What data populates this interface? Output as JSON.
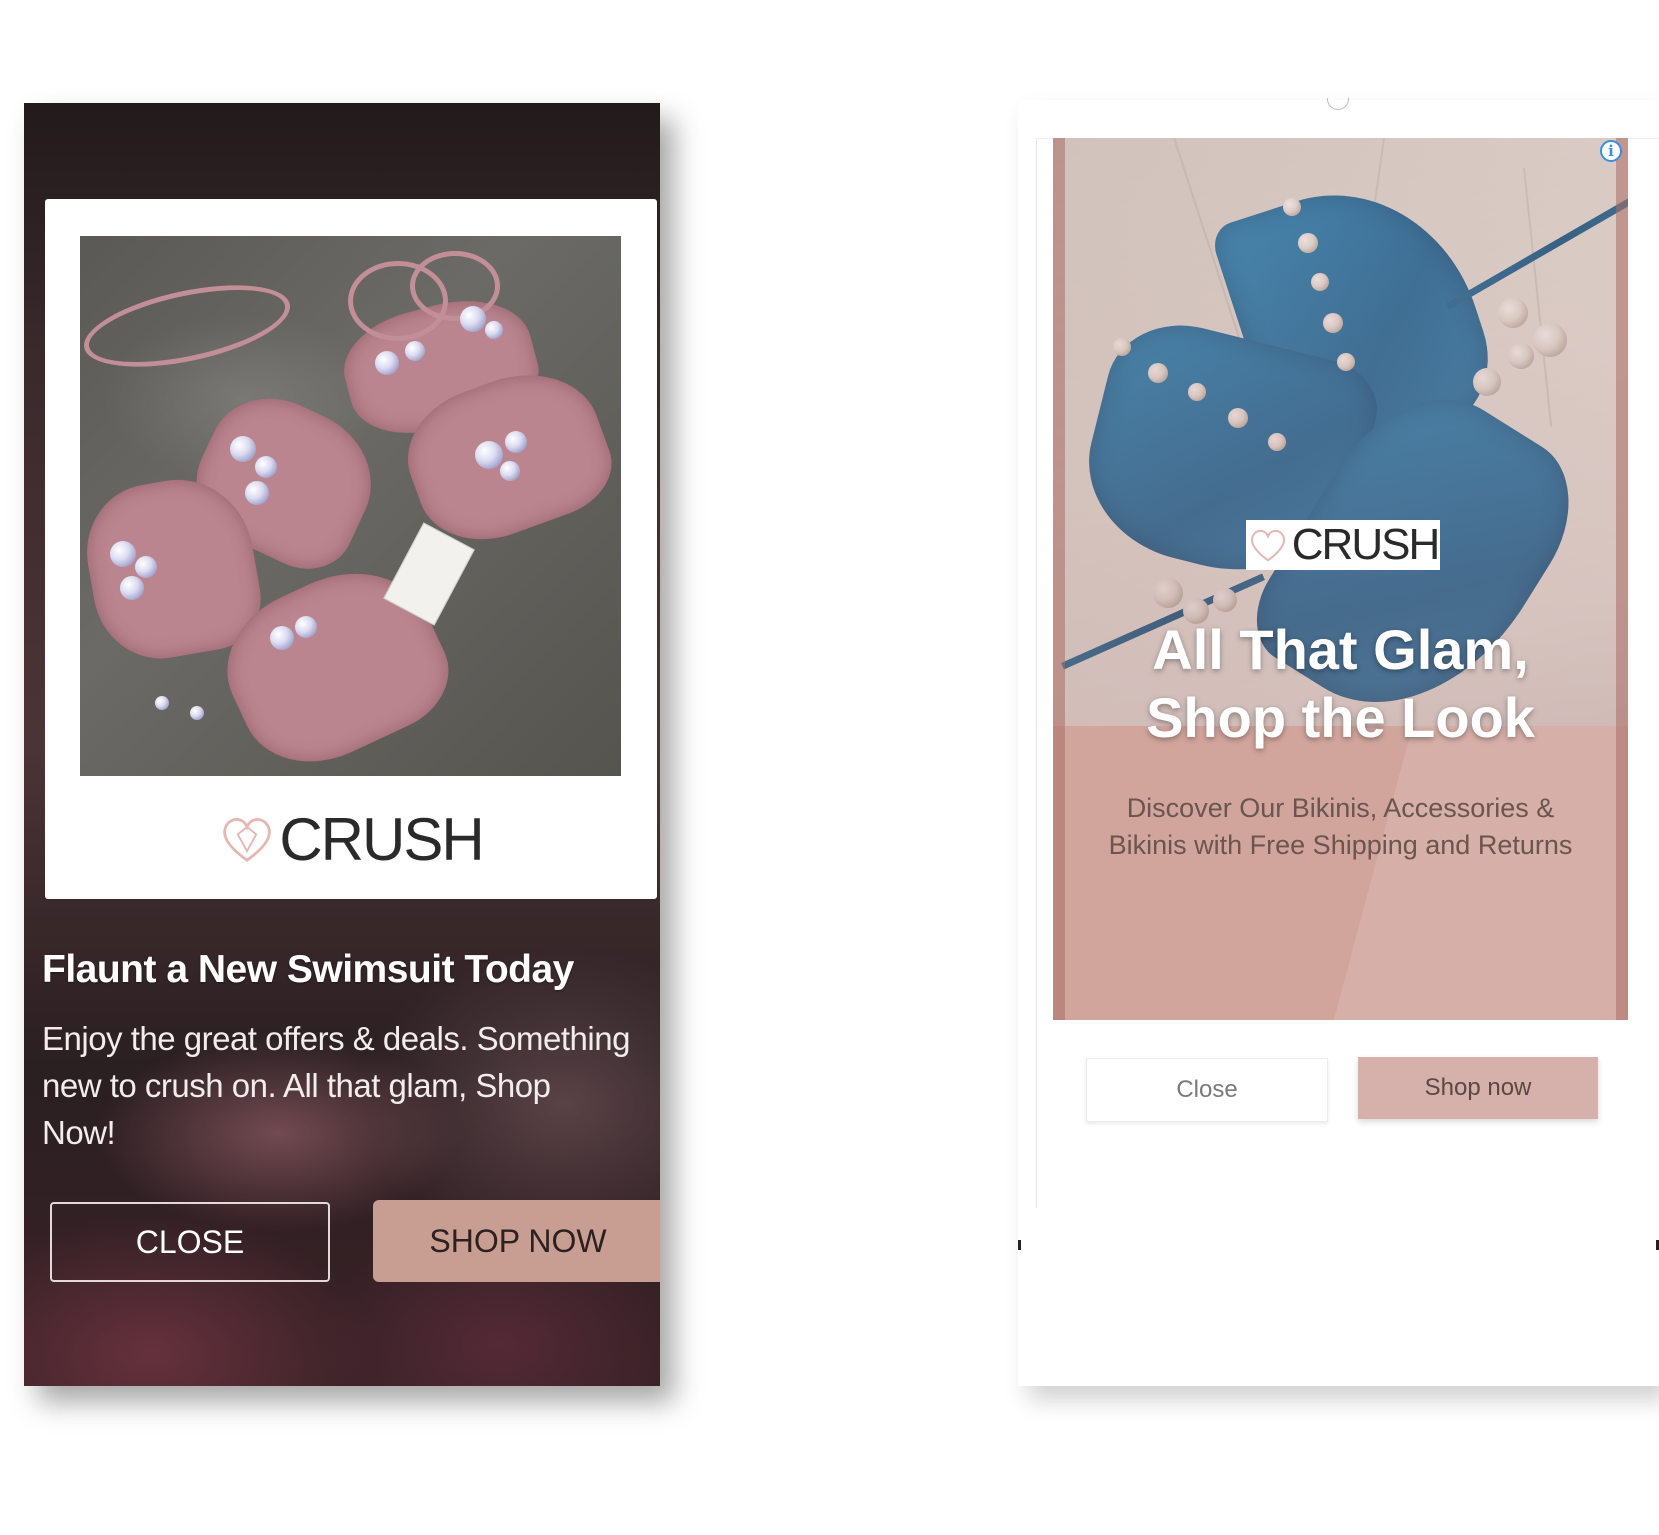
{
  "left_ad": {
    "brand_name": "CRUSH",
    "headline": "Flaunt a New Swimsuit Today",
    "body": "Enjoy the great offers & deals. Something new to crush on. All that glam, Shop Now!",
    "close_label": "CLOSE",
    "shop_label": "SHOP NOW",
    "colors": {
      "background": "#3a2a2c",
      "shop_button": "#c89e93",
      "product": "#bb8590"
    }
  },
  "right_ad": {
    "brand_name": "CRUSH",
    "headline_line1": "All That Glam,",
    "headline_line2": "Shop the Look",
    "sub_line1": "Discover Our Bikinis, Accessories &",
    "sub_line2": "Bikinis with Free Shipping and Returns",
    "info_icon": "i",
    "close_label": "Close",
    "shop_label": "Shop now",
    "colors": {
      "panel": "#d1a59c",
      "shop_button": "#d6b0aa",
      "product": "#2b8bc0",
      "info_icon": "#3b8fe0"
    }
  }
}
